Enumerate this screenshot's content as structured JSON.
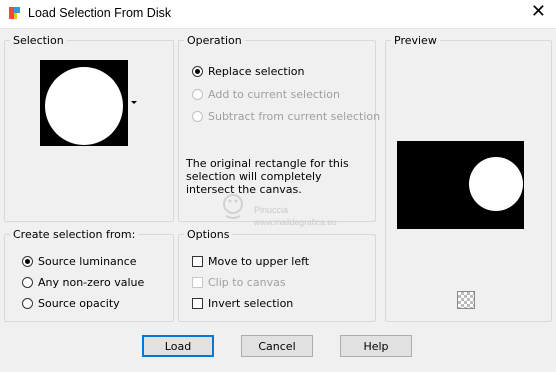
{
  "window": {
    "title": "Load Selection From Disk",
    "close_glyph": "✕"
  },
  "selection": {
    "legend": "Selection"
  },
  "operation": {
    "legend": "Operation",
    "options": [
      {
        "label": "Replace selection",
        "selected": true,
        "enabled": true
      },
      {
        "label": "Add to current selection",
        "selected": false,
        "enabled": false
      },
      {
        "label": "Subtract from current selection",
        "selected": false,
        "enabled": false
      }
    ],
    "info": "The original rectangle for this selection will completely intersect the canvas."
  },
  "preview": {
    "legend": "Preview"
  },
  "create_from": {
    "legend": "Create selection from:",
    "options": [
      {
        "label": "Source luminance",
        "selected": true
      },
      {
        "label": "Any non-zero value",
        "selected": false
      },
      {
        "label": "Source opacity",
        "selected": false
      }
    ]
  },
  "options": {
    "legend": "Options",
    "items": [
      {
        "label": "Move to upper left",
        "checked": false,
        "enabled": true
      },
      {
        "label": "Clip to canvas",
        "checked": false,
        "enabled": false
      },
      {
        "label": "Invert selection",
        "checked": false,
        "enabled": true
      }
    ]
  },
  "buttons": {
    "load": "Load",
    "cancel": "Cancel",
    "help": "Help"
  },
  "watermark": {
    "name": "Pinuccia",
    "url": "www.maildegrafica.eu"
  },
  "colors": {
    "accent": "#0078d7",
    "panel_bg": "#f0f0f0"
  }
}
